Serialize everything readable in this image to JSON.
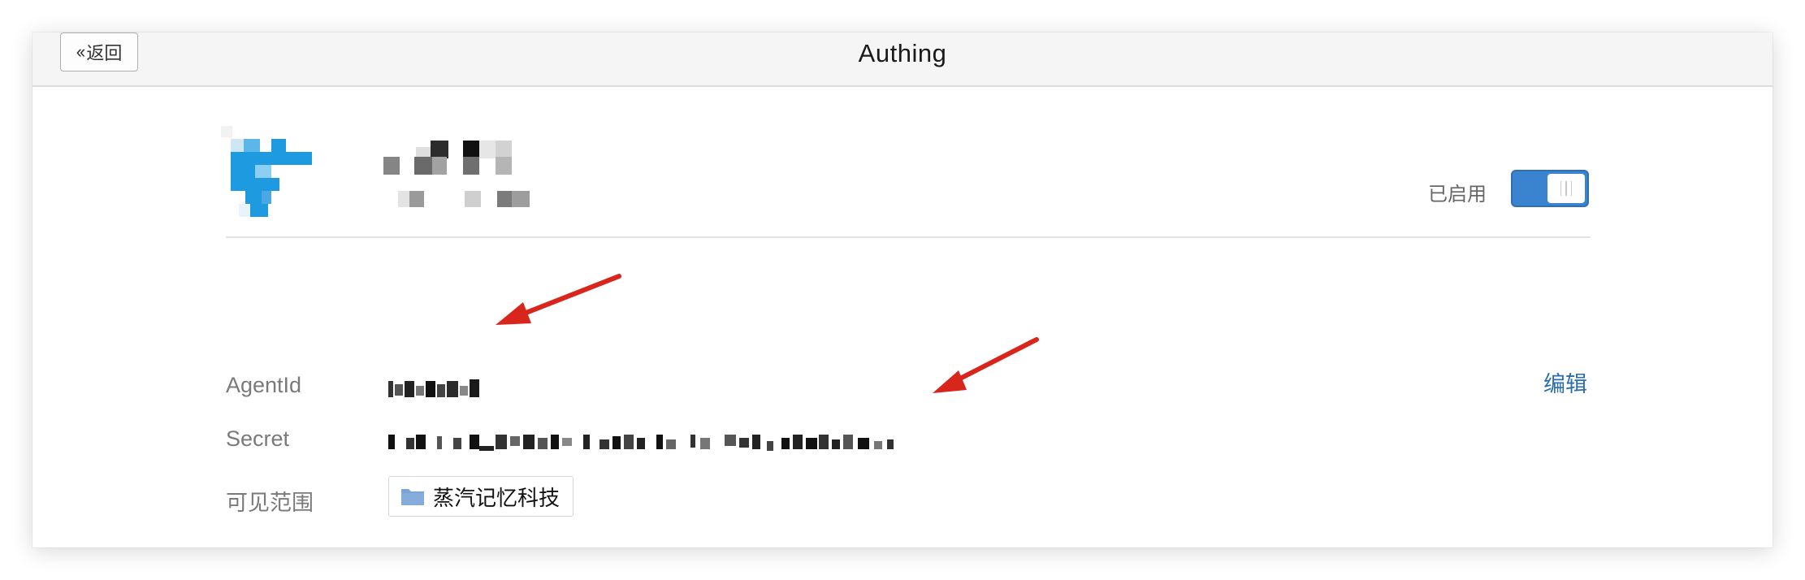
{
  "window": {
    "title": "Authing",
    "back_label": "返回"
  },
  "app": {
    "status_label": "已启用",
    "toggle_on": true,
    "edit_label": "编辑"
  },
  "details": {
    "agent_id_label": "AgentId",
    "secret_label": "Secret",
    "scope_label": "可见范围",
    "scope_value": "蒸汽记忆科技"
  },
  "icons": {
    "back": "double-chevron-left-icon",
    "folder": "folder-icon"
  },
  "colors": {
    "accent": "#3a84cf",
    "link": "#2a6ead",
    "annotation_arrow": "#d9261c",
    "logo": "#1e9be0"
  }
}
